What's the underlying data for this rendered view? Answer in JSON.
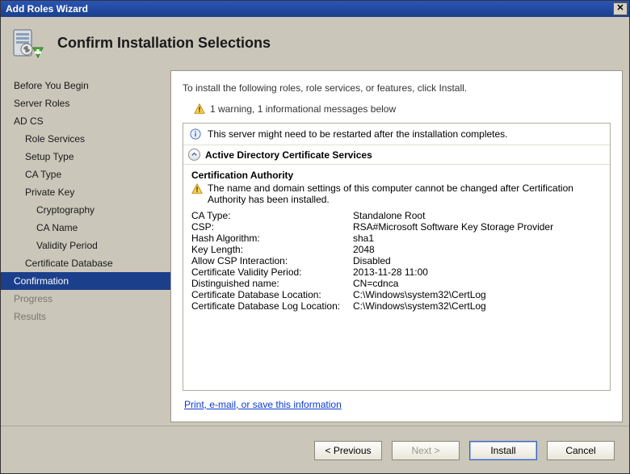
{
  "window": {
    "title": "Add Roles Wizard"
  },
  "header": {
    "title": "Confirm Installation Selections"
  },
  "sidebar": {
    "items": [
      {
        "label": "Before You Begin",
        "level": 0
      },
      {
        "label": "Server Roles",
        "level": 0
      },
      {
        "label": "AD CS",
        "level": 0
      },
      {
        "label": "Role Services",
        "level": 1
      },
      {
        "label": "Setup Type",
        "level": 1
      },
      {
        "label": "CA Type",
        "level": 1
      },
      {
        "label": "Private Key",
        "level": 1
      },
      {
        "label": "Cryptography",
        "level": 2
      },
      {
        "label": "CA Name",
        "level": 2
      },
      {
        "label": "Validity Period",
        "level": 2
      },
      {
        "label": "Certificate Database",
        "level": 1
      },
      {
        "label": "Confirmation",
        "level": 0,
        "selected": true
      },
      {
        "label": "Progress",
        "level": 0,
        "disabled": true
      },
      {
        "label": "Results",
        "level": 0,
        "disabled": true
      }
    ]
  },
  "content": {
    "intro": "To install the following roles, role services, or features, click Install.",
    "warn_summary": "1 warning, 1 informational messages below",
    "info_msg": "This server might need to be restarted after the installation completes.",
    "section_title": "Active Directory Certificate Services",
    "sub_heading": "Certification Authority",
    "warning_detail": "The name and domain settings of this computer cannot be changed after Certification Authority has been installed.",
    "rows": [
      {
        "k": "CA Type:",
        "v": "Standalone Root"
      },
      {
        "k": "CSP:",
        "v": "RSA#Microsoft Software Key Storage Provider"
      },
      {
        "k": "Hash Algorithm:",
        "v": "sha1"
      },
      {
        "k": "Key Length:",
        "v": "2048"
      },
      {
        "k": "Allow CSP Interaction:",
        "v": "Disabled"
      },
      {
        "k": "Certificate Validity Period:",
        "v": "2013-11-28 11:00"
      },
      {
        "k": "Distinguished name:",
        "v": "CN=cdnca"
      },
      {
        "k": "Certificate Database Location:",
        "v": "C:\\Windows\\system32\\CertLog"
      },
      {
        "k": "Certificate Database Log Location:",
        "v": "C:\\Windows\\system32\\CertLog"
      }
    ],
    "link_text": "Print, e-mail, or save this information"
  },
  "footer": {
    "previous": "< Previous",
    "next": "Next >",
    "install": "Install",
    "cancel": "Cancel"
  }
}
